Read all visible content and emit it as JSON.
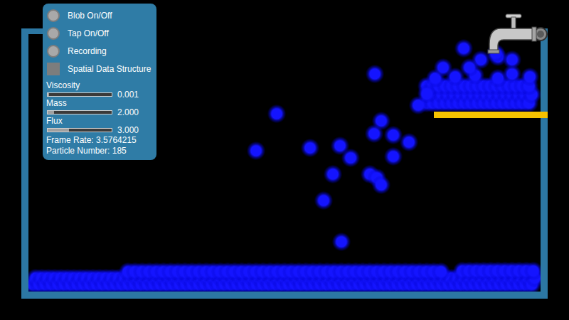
{
  "panel": {
    "toggles": [
      {
        "label": "Blob On/Off",
        "kind": "toggle",
        "on": false
      },
      {
        "label": "Tap On/Off",
        "kind": "toggle",
        "on": false
      },
      {
        "label": "Recording",
        "kind": "toggle",
        "on": false
      },
      {
        "label": "Spatial Data Structure",
        "kind": "checkbox",
        "on": false
      }
    ],
    "sliders": [
      {
        "label": "Viscosity",
        "level": 0.02,
        "reading": "0.001"
      },
      {
        "label": "Mass",
        "level": 0.1,
        "reading": "2.000"
      },
      {
        "label": "Flux",
        "level": 0.33,
        "reading": "3.000"
      }
    ],
    "stats": [
      {
        "label": "Frame Rate:",
        "value": "3.5764215"
      },
      {
        "label": "Particle Number:",
        "value": "185"
      }
    ]
  }
}
